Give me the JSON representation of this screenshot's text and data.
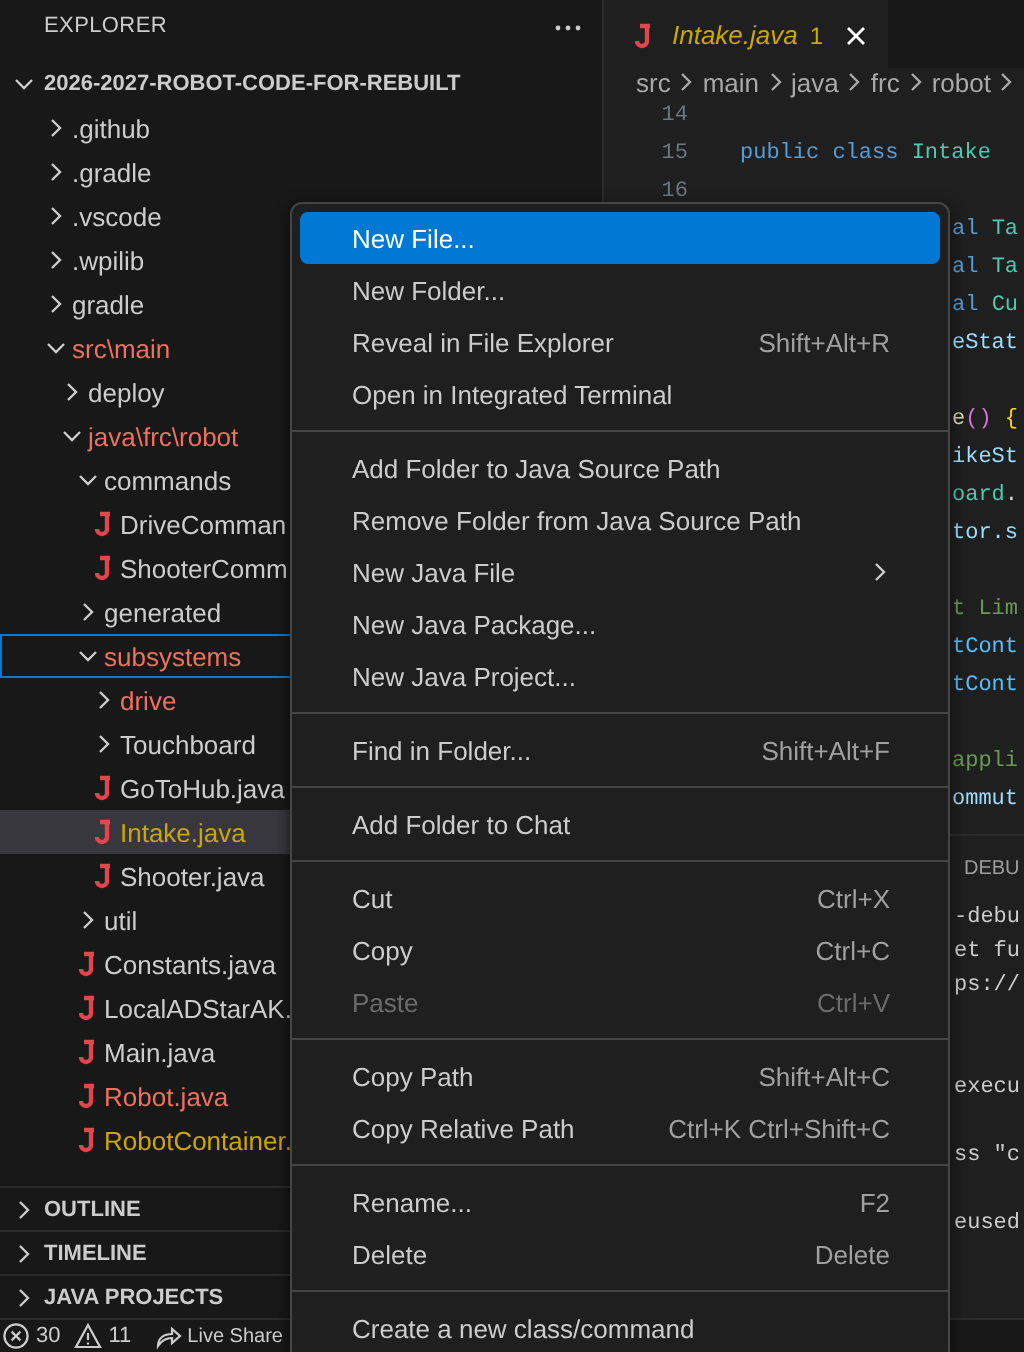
{
  "explorer": {
    "title": "EXPLORER",
    "root": {
      "label": "2026-2027-ROBOT-CODE-FOR-REBUILT",
      "expanded": true
    },
    "tree": [
      {
        "label": ".github",
        "kind": "folder",
        "expanded": false,
        "color": "#cccccc",
        "selected": false,
        "focused": false
      },
      {
        "label": ".gradle",
        "kind": "folder",
        "expanded": false,
        "color": "#cccccc",
        "selected": false,
        "focused": false
      },
      {
        "label": ".vscode",
        "kind": "folder",
        "expanded": false,
        "color": "#cccccc",
        "selected": false,
        "focused": false
      },
      {
        "label": ".wpilib",
        "kind": "folder",
        "expanded": false,
        "color": "#cccccc",
        "selected": false,
        "focused": false
      },
      {
        "label": "gradle",
        "kind": "folder",
        "expanded": false,
        "color": "#cccccc",
        "selected": false,
        "focused": false
      },
      {
        "label": "src\\main",
        "kind": "folder",
        "expanded": true,
        "color": "#f0705e",
        "selected": false,
        "focused": false,
        "children": [
          {
            "label": "deploy",
            "kind": "folder",
            "expanded": false,
            "color": "#cccccc",
            "selected": false,
            "focused": false
          },
          {
            "label": "java\\frc\\robot",
            "kind": "folder",
            "expanded": true,
            "color": "#f0705e",
            "selected": false,
            "focused": false,
            "children": [
              {
                "label": "commands",
                "kind": "folder",
                "expanded": true,
                "color": "#cccccc",
                "selected": false,
                "focused": false,
                "children": [
                  {
                    "label": "DriveComman",
                    "kind": "file",
                    "color": "#cccccc",
                    "selected": false,
                    "focused": false
                  },
                  {
                    "label": "ShooterComm",
                    "kind": "file",
                    "color": "#cccccc",
                    "selected": false,
                    "focused": false
                  }
                ]
              },
              {
                "label": "generated",
                "kind": "folder",
                "expanded": false,
                "color": "#cccccc",
                "selected": false,
                "focused": false
              },
              {
                "label": "subsystems",
                "kind": "folder",
                "expanded": true,
                "color": "#f0705e",
                "selected": false,
                "focused": true,
                "children": [
                  {
                    "label": "drive",
                    "kind": "folder",
                    "expanded": false,
                    "color": "#f0705e",
                    "selected": false,
                    "focused": false
                  },
                  {
                    "label": "Touchboard",
                    "kind": "folder",
                    "expanded": false,
                    "color": "#cccccc",
                    "selected": false,
                    "focused": false
                  },
                  {
                    "label": "GoToHub.java",
                    "kind": "file",
                    "color": "#cccccc",
                    "selected": false,
                    "focused": false
                  },
                  {
                    "label": "Intake.java",
                    "kind": "file",
                    "color": "#cca700",
                    "selected": true,
                    "focused": false
                  },
                  {
                    "label": "Shooter.java",
                    "kind": "file",
                    "color": "#cccccc",
                    "selected": false,
                    "focused": false
                  }
                ]
              },
              {
                "label": "util",
                "kind": "folder",
                "expanded": false,
                "color": "#cccccc",
                "selected": false,
                "focused": false
              },
              {
                "label": "Constants.java",
                "kind": "file",
                "color": "#cccccc",
                "selected": false,
                "focused": false
              },
              {
                "label": "LocalADStarAK.",
                "kind": "file",
                "color": "#cccccc",
                "selected": false,
                "focused": false
              },
              {
                "label": "Main.java",
                "kind": "file",
                "color": "#cccccc",
                "selected": false,
                "focused": false
              },
              {
                "label": "Robot.java",
                "kind": "file",
                "color": "#f0705e",
                "selected": false,
                "focused": false
              },
              {
                "label": "RobotContainer.",
                "kind": "file",
                "color": "#cca700",
                "selected": false,
                "focused": false
              }
            ]
          }
        ]
      }
    ],
    "sections": [
      {
        "label": "OUTLINE",
        "expanded": false
      },
      {
        "label": "TIMELINE",
        "expanded": false
      },
      {
        "label": "JAVA PROJECTS",
        "expanded": false
      }
    ]
  },
  "editor": {
    "tabs": [
      {
        "label": "Intake.java",
        "badge": "1",
        "color": "#cca700",
        "selected": true
      }
    ],
    "breadcrumbs": [
      "src",
      "main",
      "java",
      "frc",
      "robot"
    ],
    "lines": [
      {
        "kind": "code",
        "number": "14"
      },
      {
        "kind": "code",
        "number": "15",
        "parts": [
          {
            "text": "public class ",
            "kind": "keyword"
          },
          {
            "text": "Intake",
            "kind": "type"
          }
        ]
      },
      {
        "kind": "code",
        "number": "16"
      },
      {
        "kind": "code",
        "parts": [
          {
            "text": "al ",
            "kind": "keyword"
          },
          {
            "text": "Ta",
            "kind": "type"
          }
        ]
      },
      {
        "kind": "code",
        "parts": [
          {
            "text": "al ",
            "kind": "keyword"
          },
          {
            "text": "Ta",
            "kind": "type"
          }
        ]
      },
      {
        "kind": "code",
        "parts": [
          {
            "text": "al ",
            "kind": "keyword"
          },
          {
            "text": "Cu",
            "kind": "type"
          }
        ]
      },
      {
        "kind": "code",
        "parts": [
          {
            "text": "eStat",
            "kind": "variable"
          }
        ]
      },
      {
        "kind": "blank"
      },
      {
        "kind": "code",
        "parts": [
          {
            "text": "e",
            "kind": "function"
          },
          {
            "text": "()",
            "kind": "bracket2"
          },
          {
            "text": " {",
            "kind": "bracket1"
          }
        ]
      },
      {
        "kind": "code",
        "parts": [
          {
            "text": "ikeSt",
            "kind": "variable"
          }
        ]
      },
      {
        "kind": "code",
        "parts": [
          {
            "text": "oard",
            "kind": "type"
          },
          {
            "text": ".",
            "kind": "plain"
          }
        ]
      },
      {
        "kind": "code",
        "parts": [
          {
            "text": "tor.s",
            "kind": "variable"
          }
        ]
      },
      {
        "kind": "blank"
      },
      {
        "kind": "code",
        "parts": [
          {
            "text": "t Lim",
            "kind": "comment"
          }
        ]
      },
      {
        "kind": "code",
        "parts": [
          {
            "text": "tCont",
            "kind": "constant"
          }
        ]
      },
      {
        "kind": "code",
        "parts": [
          {
            "text": "tCont",
            "kind": "constant"
          }
        ]
      },
      {
        "kind": "blank"
      },
      {
        "kind": "code",
        "parts": [
          {
            "text": "appli",
            "kind": "comment"
          }
        ]
      },
      {
        "kind": "code",
        "parts": [
          {
            "text": "ommut",
            "kind": "variable"
          }
        ]
      }
    ],
    "panel": {
      "tabs": [
        {
          "label": "DEBU",
          "selected": false
        }
      ],
      "lines": [
        {
          "kind": "text",
          "text": "-debu"
        },
        {
          "kind": "text",
          "text": "et fu"
        },
        {
          "kind": "text",
          "text": "ps://"
        },
        {
          "kind": "blank"
        },
        {
          "kind": "blank"
        },
        {
          "kind": "text",
          "text": "execu"
        },
        {
          "kind": "blank"
        },
        {
          "kind": "text",
          "text": "ss \"c"
        },
        {
          "kind": "blank"
        },
        {
          "kind": "text",
          "text": "eused"
        }
      ]
    }
  },
  "context_menu": {
    "groups": [
      {
        "items": [
          {
            "label": "New File...",
            "kind": "command",
            "selected": true,
            "disabled": false
          },
          {
            "label": "New Folder...",
            "kind": "command",
            "selected": false,
            "disabled": false
          },
          {
            "label": "Reveal in File Explorer",
            "shortcut": "Shift+Alt+R",
            "kind": "command",
            "selected": false,
            "disabled": false
          },
          {
            "label": "Open in Integrated Terminal",
            "kind": "command",
            "selected": false,
            "disabled": false
          }
        ]
      },
      {
        "items": [
          {
            "label": "Add Folder to Java Source Path",
            "kind": "command",
            "selected": false,
            "disabled": false
          },
          {
            "label": "Remove Folder from Java Source Path",
            "kind": "command",
            "selected": false,
            "disabled": false
          },
          {
            "label": "New Java File",
            "kind": "submenu",
            "selected": false,
            "disabled": false
          },
          {
            "label": "New Java Package...",
            "kind": "command",
            "selected": false,
            "disabled": false
          },
          {
            "label": "New Java Project...",
            "kind": "command",
            "selected": false,
            "disabled": false
          }
        ]
      },
      {
        "items": [
          {
            "label": "Find in Folder...",
            "shortcut": "Shift+Alt+F",
            "kind": "command",
            "selected": false,
            "disabled": false
          }
        ]
      },
      {
        "items": [
          {
            "label": "Add Folder to Chat",
            "kind": "command",
            "selected": false,
            "disabled": false
          }
        ]
      },
      {
        "items": [
          {
            "label": "Cut",
            "shortcut": "Ctrl+X",
            "kind": "command",
            "selected": false,
            "disabled": false
          },
          {
            "label": "Copy",
            "shortcut": "Ctrl+C",
            "kind": "command",
            "selected": false,
            "disabled": false
          },
          {
            "label": "Paste",
            "shortcut": "Ctrl+V",
            "kind": "command",
            "selected": false,
            "disabled": true
          }
        ]
      },
      {
        "items": [
          {
            "label": "Copy Path",
            "shortcut": "Shift+Alt+C",
            "kind": "command",
            "selected": false,
            "disabled": false
          },
          {
            "label": "Copy Relative Path",
            "shortcut": "Ctrl+K Ctrl+Shift+C",
            "kind": "command",
            "selected": false,
            "disabled": false
          }
        ]
      },
      {
        "items": [
          {
            "label": "Rename...",
            "shortcut": "F2",
            "kind": "command",
            "selected": false,
            "disabled": false
          },
          {
            "label": "Delete",
            "shortcut": "Delete",
            "kind": "command",
            "selected": false,
            "disabled": false
          }
        ]
      },
      {
        "items": [
          {
            "label": "Create a new class/command",
            "kind": "command",
            "selected": false,
            "disabled": false
          }
        ]
      }
    ]
  },
  "status_bar": {
    "errors": "30",
    "warnings": "11",
    "live_share": "Live Share"
  }
}
